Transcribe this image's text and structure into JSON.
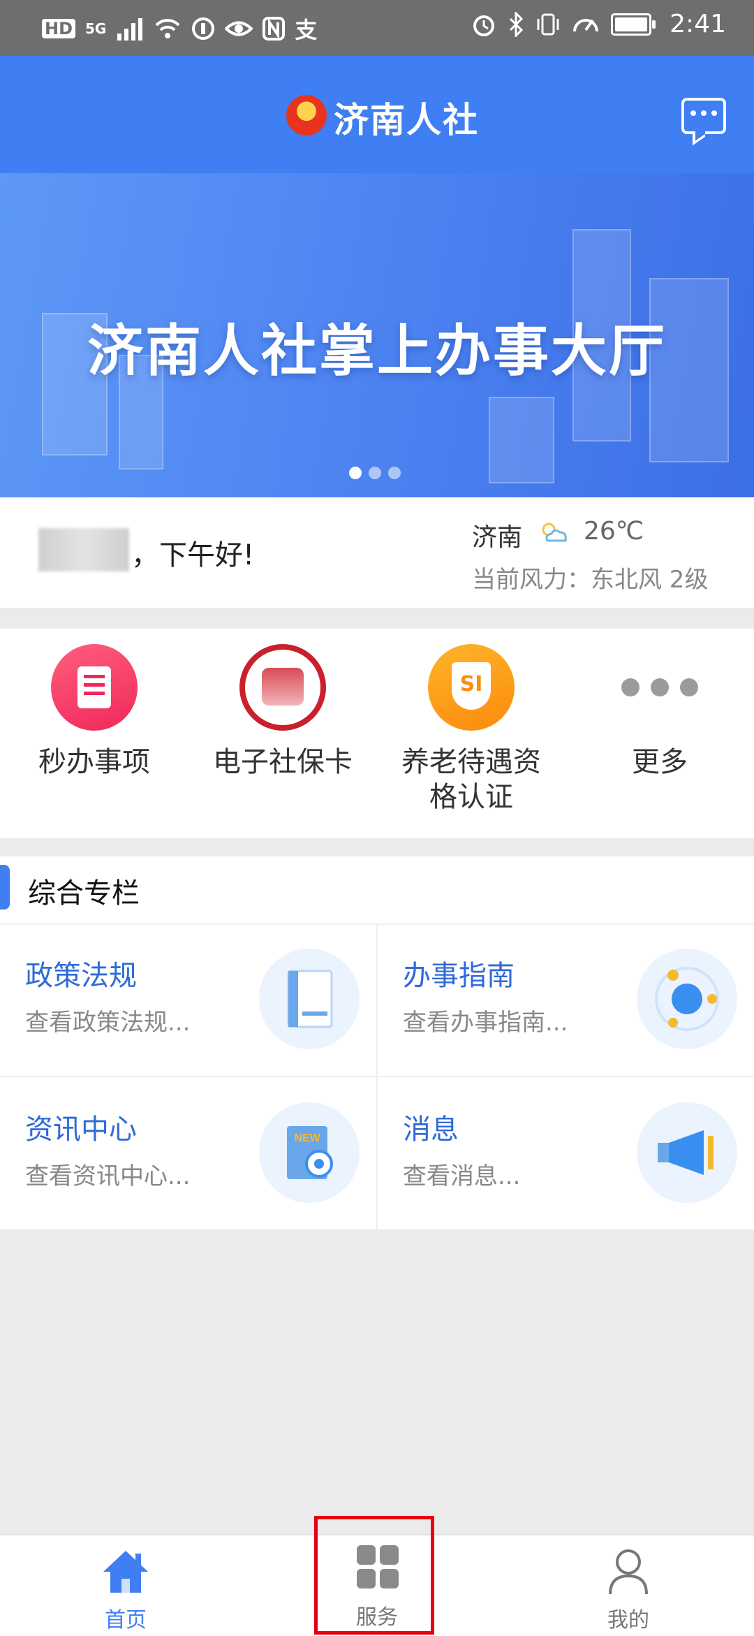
{
  "status_bar": {
    "left_icons": [
      "HD",
      "5G",
      "signal-icon",
      "wifi-icon",
      "data-saver-icon",
      "eye-icon",
      "nfc-icon",
      "alipay-icon"
    ],
    "right_icons": [
      "alarm-icon",
      "bluetooth-icon",
      "vibrate-icon",
      "speed-icon",
      "battery-icon"
    ],
    "hd_label": "HD",
    "net_label": "5G",
    "alipay_glyph": "支",
    "time": "2:41"
  },
  "header": {
    "title": "济南人社"
  },
  "banner": {
    "text": "济南人社掌上办事大厅",
    "dot_count": 3,
    "active_dot": 0
  },
  "greeting": {
    "text": "，下午好!",
    "city": "济南",
    "temperature": "26℃",
    "wind": "当前风力：东北风 2级"
  },
  "quick_menu": [
    {
      "label": "秒办事项",
      "icon": "document-icon"
    },
    {
      "label": "电子社保卡",
      "icon": "social-security-card-icon"
    },
    {
      "label": "养老待遇资格认证",
      "label_line1": "养老待遇资",
      "label_line2": "格认证",
      "icon": "si-shield-icon"
    },
    {
      "label": "更多",
      "icon": "more-dots-icon"
    }
  ],
  "section": {
    "title": "综合专栏",
    "items": [
      {
        "title": "政策法规",
        "subtitle": "查看政策法规...",
        "icon": "book-icon"
      },
      {
        "title": "办事指南",
        "subtitle": "查看办事指南...",
        "icon": "guide-orbit-icon"
      },
      {
        "title": "资讯中心",
        "subtitle": "查看资讯中心...",
        "icon": "news-icon",
        "badge": "NEW"
      },
      {
        "title": "消息",
        "subtitle": "查看消息...",
        "icon": "megaphone-icon"
      }
    ]
  },
  "tabbar": {
    "tabs": [
      {
        "label": "首页",
        "icon": "home-icon",
        "active": true
      },
      {
        "label": "服务",
        "icon": "grid-icon",
        "active": false,
        "highlighted": true
      },
      {
        "label": "我的",
        "icon": "user-icon",
        "active": false
      }
    ]
  },
  "colors": {
    "primary": "#3f7ef3",
    "link": "#2f6ad9",
    "highlight_box": "#e60012",
    "tab_inactive": "#8a8a8a"
  }
}
